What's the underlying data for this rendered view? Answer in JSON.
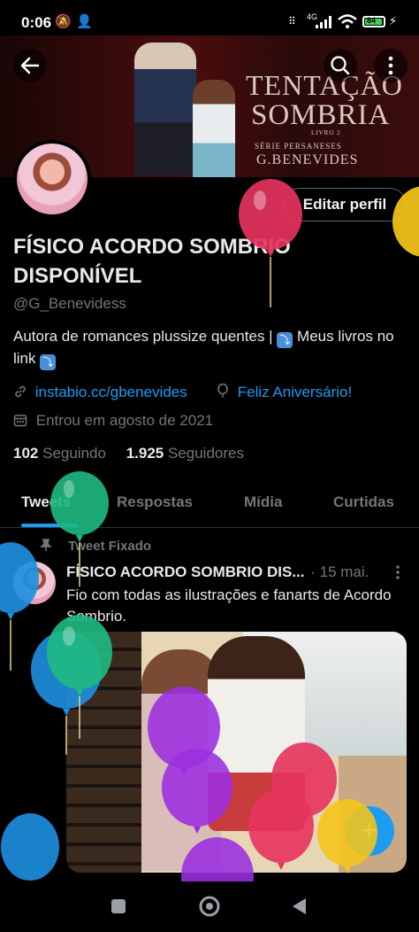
{
  "status_bar": {
    "time": "0:06",
    "network": "4G",
    "battery": "84"
  },
  "banner": {
    "book_title_line1": "TENTAÇÃO",
    "book_title_line2": "SOMBRIA",
    "book_subtitle": "LIVRO 2",
    "series": "SÉRIE PERSANESES",
    "author": "G.BENEVIDES"
  },
  "profile": {
    "edit_button": "Editar perfil",
    "display_name": "FÍSICO ACORDO SOMBRIO DISPONÍVEL",
    "handle": "@G_Benevidess",
    "bio_part1": "Autora de romances plussize quentes | ",
    "bio_part2": " Meus livros no link ",
    "link": "instabio.cc/gbenevides",
    "birthday": "Feliz Aniversário!",
    "joined": "Entrou em agosto de 2021",
    "following_count": "102",
    "following_label": "Seguindo",
    "followers_count": "1.925",
    "followers_label": "Seguidores"
  },
  "tabs": [
    {
      "label": "Tweets"
    },
    {
      "label": "Respostas"
    },
    {
      "label": "Mídia"
    },
    {
      "label": "Curtidas"
    }
  ],
  "tweet": {
    "pinned_label": "Tweet Fixado",
    "author": "FÍSICO ACORDO SOMBRIO DIS...",
    "date": "· 15 mai.",
    "text": "Fio com todas as ilustrações e fanarts de Acordo Sombrio."
  },
  "colors": {
    "accent": "#1d9bf0",
    "background": "#000000",
    "secondary_text": "#71767b"
  },
  "icons": [
    "back-arrow-icon",
    "search-icon",
    "more-vertical-icon",
    "link-icon",
    "balloon-icon",
    "calendar-icon",
    "pin-icon",
    "compose-plus-icon",
    "nav-recents-icon",
    "nav-home-icon",
    "nav-back-icon"
  ]
}
